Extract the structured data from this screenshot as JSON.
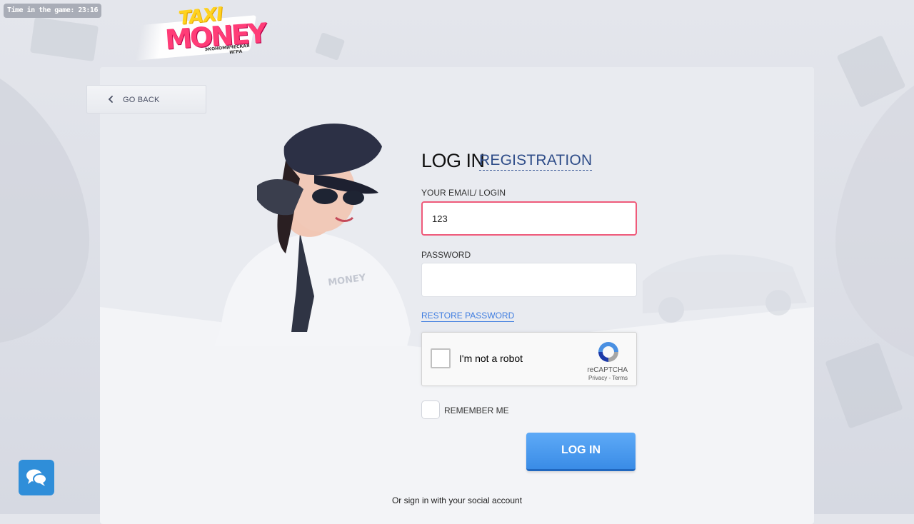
{
  "timer": {
    "label": "Time in the game: 23:16"
  },
  "logo": {
    "line1": "TAXI",
    "line2": "MONEY",
    "tagline": "экономическая игра"
  },
  "nav": {
    "back_label": "GO BACK"
  },
  "form": {
    "title": "LOG IN",
    "registration_link": "REGISTRATION",
    "email_label": "YOUR EMAIL/ LOGIN",
    "email_value": "123",
    "password_label": "PASSWORD",
    "password_value": "",
    "restore_link": "RESTORE PASSWORD",
    "remember_label": "REMEMBER ME",
    "submit_label": "LOG IN",
    "social_text": "Or sign in with your social account"
  },
  "captcha": {
    "label": "I'm not a robot",
    "brand": "reCAPTCHA",
    "links": "Privacy - Terms"
  },
  "colors": {
    "accent": "#3a8ce6",
    "error_border": "#ef5a7a",
    "link": "#3f7de0",
    "registration": "#2e4c88",
    "chat_button": "#2f8ed9"
  },
  "icons": {
    "back": "chevron-left-icon",
    "chat": "chat-bubbles-icon",
    "captcha": "recaptcha-icon"
  }
}
